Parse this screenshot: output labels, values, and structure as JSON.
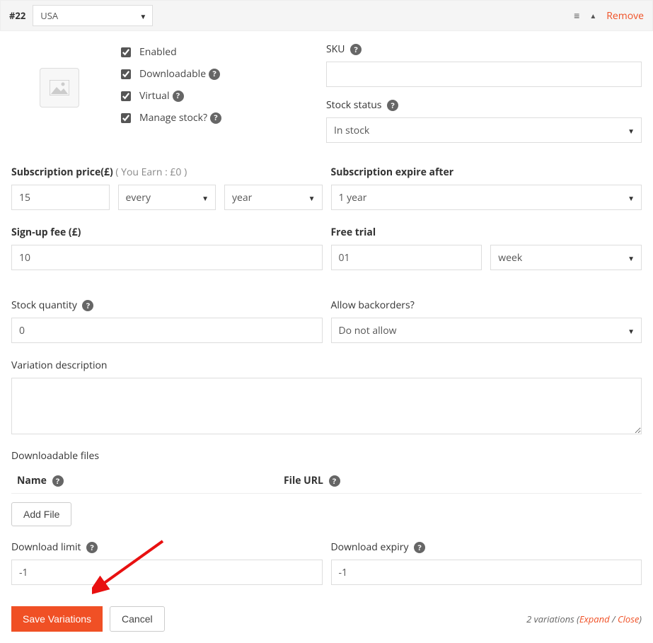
{
  "header": {
    "id": "#22",
    "country": "USA",
    "remove": "Remove"
  },
  "checks": {
    "enabled": "Enabled",
    "downloadable": "Downloadable",
    "virtual": "Virtual",
    "manage_stock": "Manage stock?"
  },
  "sku": {
    "label": "SKU",
    "value": ""
  },
  "stock_status": {
    "label": "Stock status",
    "value": "In stock"
  },
  "sub_price": {
    "label": "Subscription price(£)",
    "earn": "( You Earn : £0 )",
    "value": "15",
    "interval": "every",
    "unit": "year"
  },
  "sub_expire": {
    "label": "Subscription expire after",
    "value": "1 year"
  },
  "signup_fee": {
    "label": "Sign-up fee (£)",
    "value": "10"
  },
  "free_trial": {
    "label": "Free trial",
    "value": "01",
    "unit": "week"
  },
  "stock_qty": {
    "label": "Stock quantity",
    "value": "0"
  },
  "backorders": {
    "label": "Allow backorders?",
    "value": "Do not allow"
  },
  "description": {
    "label": "Variation description",
    "value": ""
  },
  "files": {
    "label": "Downloadable files",
    "name_col": "Name",
    "url_col": "File URL",
    "add_btn": "Add File"
  },
  "dl_limit": {
    "label": "Download limit",
    "value": "-1"
  },
  "dl_expiry": {
    "label": "Download expiry",
    "value": "-1"
  },
  "footer": {
    "save": "Save Variations",
    "cancel": "Cancel",
    "count": "2 variations",
    "expand": "Expand",
    "close": "Close"
  }
}
